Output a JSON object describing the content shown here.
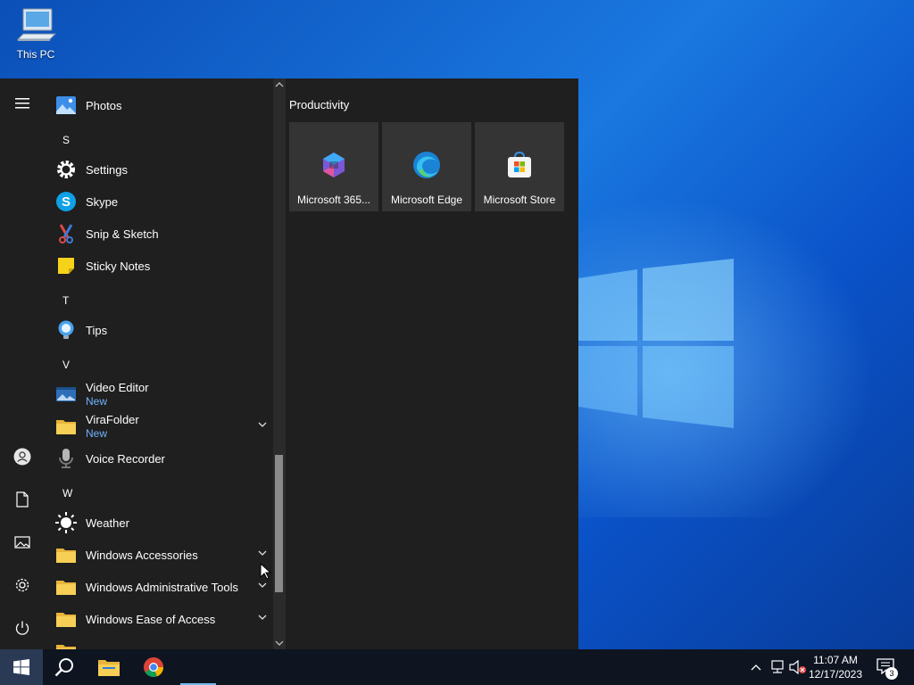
{
  "desktop": {
    "icons": [
      {
        "label": "This PC",
        "icon": "computer-icon"
      }
    ]
  },
  "start_menu": {
    "left_rail": [
      "hamburger-menu-icon",
      "user-account-icon",
      "documents-icon",
      "pictures-icon",
      "settings-icon",
      "power-icon"
    ],
    "apps": [
      {
        "type": "app",
        "name": "Photos",
        "icon": "photos-icon"
      },
      {
        "type": "letter",
        "name": "S"
      },
      {
        "type": "app",
        "name": "Settings",
        "icon": "gear-icon"
      },
      {
        "type": "app",
        "name": "Skype",
        "icon": "skype-icon"
      },
      {
        "type": "app",
        "name": "Snip & Sketch",
        "icon": "snip-sketch-icon"
      },
      {
        "type": "app",
        "name": "Sticky Notes",
        "icon": "sticky-notes-icon"
      },
      {
        "type": "letter",
        "name": "T"
      },
      {
        "type": "app",
        "name": "Tips",
        "icon": "tips-icon"
      },
      {
        "type": "letter",
        "name": "V"
      },
      {
        "type": "app",
        "name": "Video Editor",
        "badge": "New",
        "icon": "video-editor-icon"
      },
      {
        "type": "folder",
        "name": "ViraFolder",
        "badge": "New",
        "icon": "folder-icon"
      },
      {
        "type": "app",
        "name": "Voice Recorder",
        "icon": "microphone-icon"
      },
      {
        "type": "letter",
        "name": "W"
      },
      {
        "type": "app",
        "name": "Weather",
        "icon": "sun-icon"
      },
      {
        "type": "folder",
        "name": "Windows Accessories",
        "icon": "folder-icon"
      },
      {
        "type": "folder",
        "name": "Windows Administrative Tools",
        "icon": "folder-icon"
      },
      {
        "type": "folder",
        "name": "Windows Ease of Access",
        "icon": "folder-icon"
      }
    ],
    "tiles_group": {
      "title": "Productivity",
      "tiles": [
        {
          "label": "Microsoft 365...",
          "icon": "microsoft-365-icon"
        },
        {
          "label": "Microsoft Edge",
          "icon": "edge-icon"
        },
        {
          "label": "Microsoft Store",
          "icon": "store-icon"
        }
      ]
    }
  },
  "taskbar": {
    "pinned": [
      "windows-start-icon",
      "search-icon",
      "file-explorer-icon",
      "chrome-icon"
    ],
    "clock": {
      "time": "11:07 AM",
      "date": "12/17/2023"
    },
    "notification_count": "3"
  },
  "colors": {
    "menu_bg": "#1f1f1f",
    "tile_bg": "#343434",
    "badge_new": "#6fb3ff",
    "taskbar_bg": "#0e1521",
    "desktop_blue": "#1a78e0"
  }
}
